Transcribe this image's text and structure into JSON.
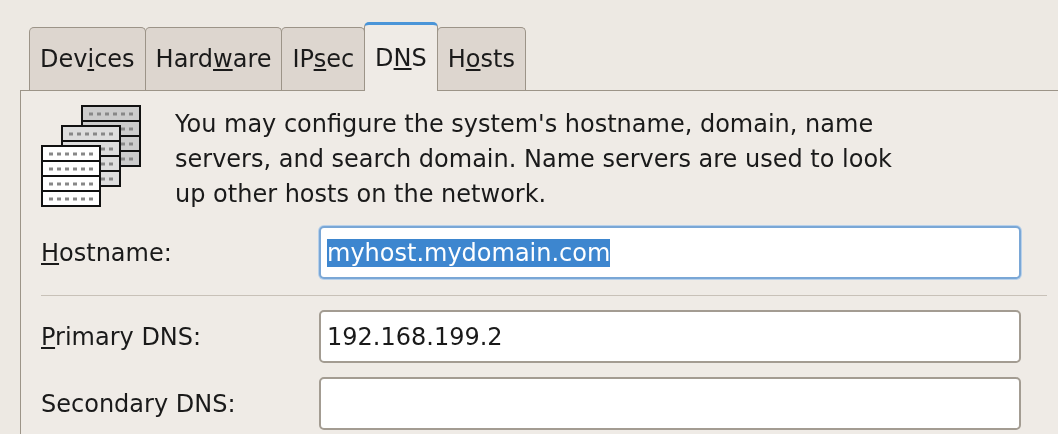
{
  "tabs": [
    {
      "label": {
        "before": "Dev",
        "key": "i",
        "after": "ces"
      },
      "selected": false
    },
    {
      "label": {
        "before": "Hard",
        "key": "w",
        "after": "are"
      },
      "selected": false
    },
    {
      "label": {
        "before": "IP",
        "key": "s",
        "after": "ec"
      },
      "selected": false
    },
    {
      "label": {
        "before": "D",
        "key": "N",
        "after": "S"
      },
      "selected": true
    },
    {
      "label": {
        "before": "H",
        "key": "o",
        "after": "sts"
      },
      "selected": false
    }
  ],
  "description": "You may configure the system's hostname, domain, name servers, and search domain. Name servers are used to look up other hosts on the network.",
  "fields": [
    {
      "label": {
        "key": "H",
        "after": "ostname:"
      },
      "value": "myhost.mydomain.com",
      "focused": true,
      "text_selected": true
    },
    {
      "label": {
        "key": "P",
        "after": "rimary DNS:"
      },
      "value": "192.168.199.2",
      "focused": false,
      "text_selected": false
    },
    {
      "label": {
        "before": "Secondary DNS:"
      },
      "focused": false
    }
  ]
}
